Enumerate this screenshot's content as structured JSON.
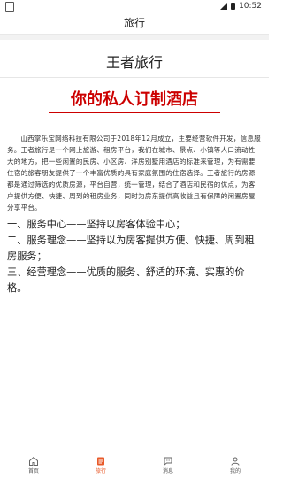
{
  "status_bar": {
    "time": "10:52"
  },
  "app_bar": {
    "title": "旅行"
  },
  "page": {
    "title": "王者旅行",
    "slogan": "你的私人订制酒店",
    "intro": "山西掌乐宝网络科技有限公司于2018年12月成立，主要经营软件开发，信息服务。王者旅行是一个网上旅游、租房平台，我们在城市、景点、小镇等人口流动性大的地方，把一些闲置的民房、小区房、洋房别墅用酒店的标准来管理，为有需要住宿的旅客朋友提供了一个丰富优质的具有家庭氛围的住宿选择。王者旅行的房源都是通过筛选的优质房源，平台自营，统一管理，结合了酒店和民宿的优点，为客户提供方便、快捷、周到的租房业务，同时为房东提供高收益且有保障的闲置房屋分享平台。",
    "points": [
      "一、服务中心——坚持以房客体验中心；",
      "二、服务理念——坚持以为房客提供方便、快捷、周到租房服务；",
      "三、经营理念——优质的服务、舒适的环境、实惠的价格。"
    ]
  },
  "tabs": [
    {
      "label": "首页",
      "icon": "home-icon"
    },
    {
      "label": "旅行",
      "icon": "travel-icon",
      "active": true
    },
    {
      "label": "消息",
      "icon": "message-icon"
    },
    {
      "label": "我的",
      "icon": "user-icon"
    }
  ],
  "colors": {
    "accent": "#e85a2a",
    "slogan": "#cc0000"
  }
}
